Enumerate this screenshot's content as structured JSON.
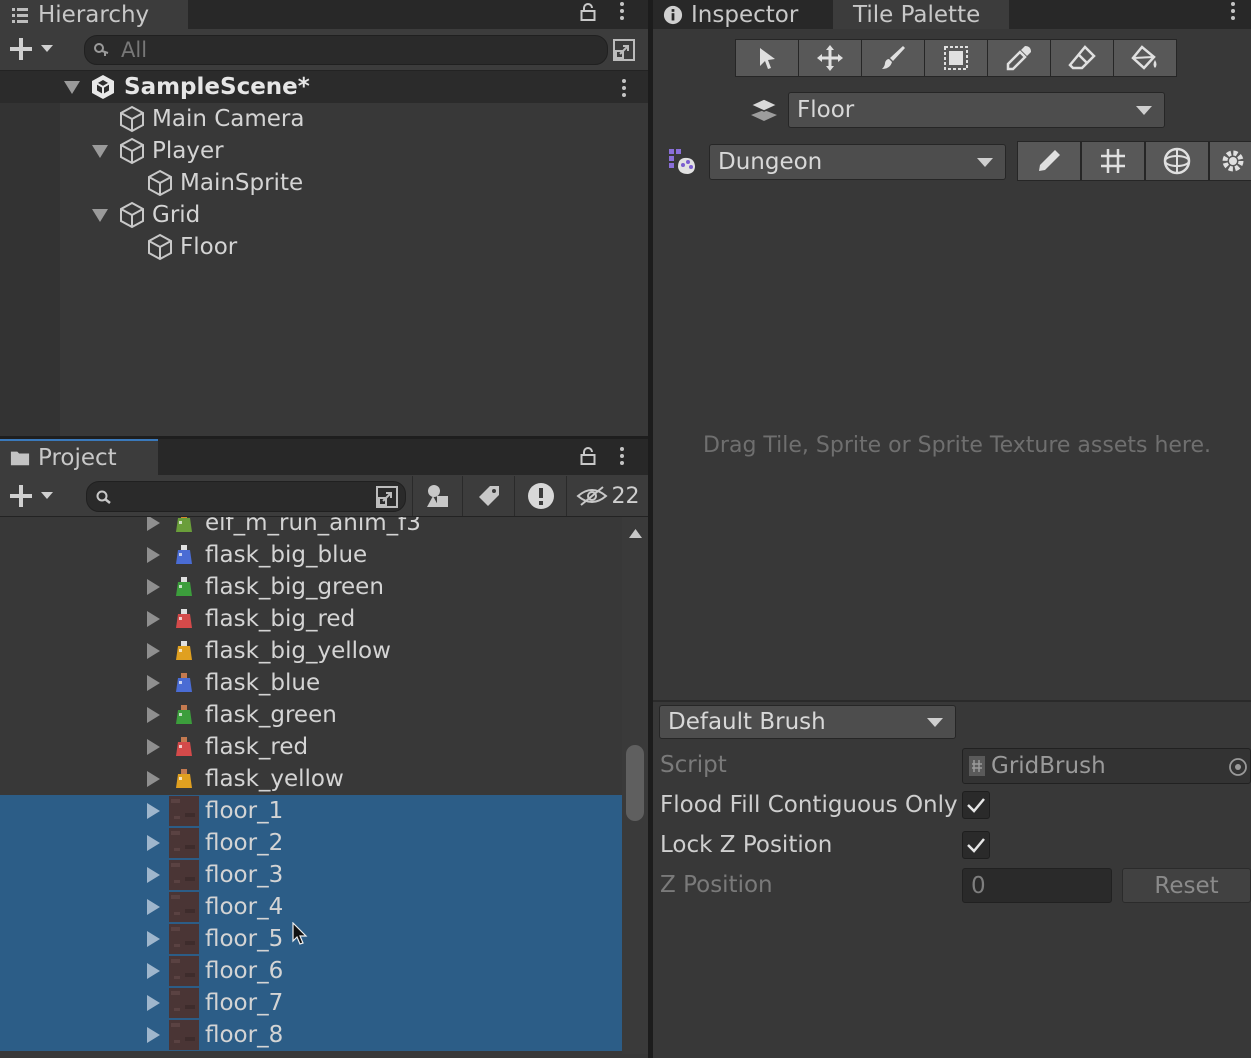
{
  "hierarchy": {
    "tab_label": "Hierarchy",
    "search_placeholder": "All",
    "scene": "SampleScene*",
    "items": [
      {
        "label": "Main Camera",
        "expandable": false
      },
      {
        "label": "Player",
        "expandable": true
      },
      {
        "label": "MainSprite",
        "expandable": false
      },
      {
        "label": "Grid",
        "expandable": true
      },
      {
        "label": "Floor",
        "expandable": false
      }
    ]
  },
  "project": {
    "tab_label": "Project",
    "search_value": "",
    "hidden_count": "22",
    "items": [
      {
        "label": "elf_m_run_anim_f3",
        "icon": "sprite-icon",
        "selected": false
      },
      {
        "label": "flask_big_blue",
        "icon": "flask-big-blue-icon",
        "selected": false
      },
      {
        "label": "flask_big_green",
        "icon": "flask-big-green-icon",
        "selected": false
      },
      {
        "label": "flask_big_red",
        "icon": "flask-big-red-icon",
        "selected": false
      },
      {
        "label": "flask_big_yellow",
        "icon": "flask-big-yellow-icon",
        "selected": false
      },
      {
        "label": "flask_blue",
        "icon": "flask-blue-icon",
        "selected": false
      },
      {
        "label": "flask_green",
        "icon": "flask-green-icon",
        "selected": false
      },
      {
        "label": "flask_red",
        "icon": "flask-red-icon",
        "selected": false
      },
      {
        "label": "flask_yellow",
        "icon": "flask-yellow-icon",
        "selected": false
      },
      {
        "label": "floor_1",
        "icon": "floor-tile-icon",
        "selected": true
      },
      {
        "label": "floor_2",
        "icon": "floor-tile-icon",
        "selected": true
      },
      {
        "label": "floor_3",
        "icon": "floor-tile-icon",
        "selected": true
      },
      {
        "label": "floor_4",
        "icon": "floor-tile-icon",
        "selected": true
      },
      {
        "label": "floor_5",
        "icon": "floor-tile-icon",
        "selected": true
      },
      {
        "label": "floor_6",
        "icon": "floor-tile-icon",
        "selected": true
      },
      {
        "label": "floor_7",
        "icon": "floor-tile-icon",
        "selected": true
      },
      {
        "label": "floor_8",
        "icon": "floor-tile-icon",
        "selected": true
      }
    ]
  },
  "inspector": {
    "tab_label": "Inspector"
  },
  "tile_palette": {
    "tab_label": "Tile Palette",
    "active_tilemap": "Floor",
    "palette": "Dungeon",
    "drop_hint": "Drag Tile, Sprite or Sprite Texture assets here.",
    "brush": "Default Brush",
    "props": {
      "script_label": "Script",
      "script_value": "GridBrush",
      "flood_label": "Flood Fill Contiguous Only",
      "lockz_label": "Lock Z Position",
      "zpos_label": "Z Position",
      "zpos_value": "0",
      "reset_label": "Reset"
    }
  },
  "colors": {
    "selection": "#2c5d87",
    "panel": "#383838",
    "tabbar": "#282828"
  }
}
